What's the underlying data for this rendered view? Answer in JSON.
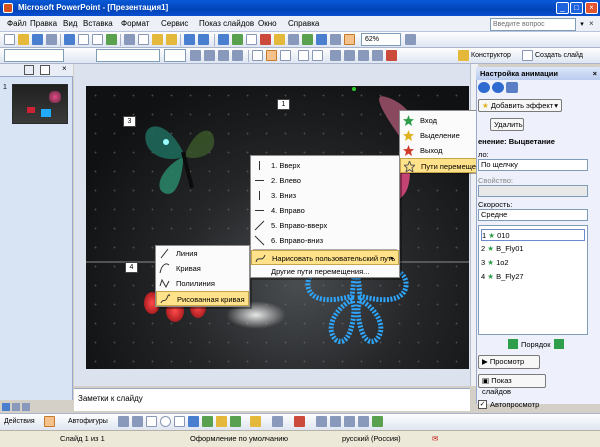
{
  "title": "Microsoft PowerPoint - [Презентация1]",
  "menu": [
    "Файл",
    "Правка",
    "Вид",
    "Вставка",
    "Формат",
    "Сервис",
    "Показ слайдов",
    "Окно",
    "Справка"
  ],
  "help_placeholder": "Введите вопрос",
  "zoom": "62%",
  "toolbar2": {
    "designer": "Конструктор",
    "new_slide": "Создать слайд"
  },
  "thumb_number": "1",
  "slide_tags": [
    "1",
    "3",
    "4"
  ],
  "notes_placeholder": "Заметки к слайду",
  "taskpane": {
    "title": "Настройка анимации",
    "add_effect": "Добавить эффект",
    "remove": "Удалить",
    "change_label": "енение: Выцветание",
    "start_label": "ло:",
    "start_value": "По щелчку",
    "property_label": "Свойство:",
    "speed_label": "Скорость:",
    "speed_value": "Средне",
    "list": [
      {
        "n": "1",
        "name": "010"
      },
      {
        "n": "2",
        "name": "B_Fly01"
      },
      {
        "n": "3",
        "name": "1o2"
      },
      {
        "n": "4",
        "name": "B_Fly27"
      }
    ],
    "order_label": "Порядок",
    "preview_btn": "Просмотр",
    "slideshow_btn": "Показ слайдов",
    "autopreview": "Автопросмотр"
  },
  "effect_menu": [
    {
      "label": "Вход",
      "hl": false
    },
    {
      "label": "Выделение",
      "hl": false
    },
    {
      "label": "Выход",
      "hl": false
    },
    {
      "label": "Пути перемещения",
      "hl": true
    }
  ],
  "motion_menu": [
    {
      "label": "1. Вверх"
    },
    {
      "label": "2. Влево"
    },
    {
      "label": "3. Вниз"
    },
    {
      "label": "4. Вправо"
    },
    {
      "label": "5. Вправо-вверх"
    },
    {
      "label": "6. Вправо-вниз"
    },
    {
      "label": "Нарисовать пользовательский путь"
    },
    {
      "label": "Другие пути перемещения..."
    }
  ],
  "draw_menu": [
    {
      "label": "Линия"
    },
    {
      "label": "Кривая"
    },
    {
      "label": "Полилиния"
    },
    {
      "label": "Рисованная кривая"
    }
  ],
  "drawbar": {
    "actions": "Действия",
    "autoshapes": "Автофигуры"
  },
  "status": {
    "slide": "Слайд 1 из 1",
    "design": "Оформление по умолчанию",
    "lang": "русский (Россия)"
  }
}
